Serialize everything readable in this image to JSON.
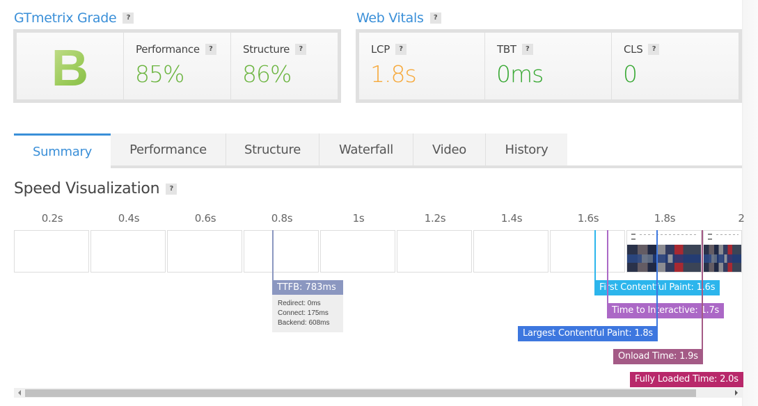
{
  "grade": {
    "title": "GTmetrix Grade",
    "help": "?",
    "letter": "B",
    "metrics": [
      {
        "label": "Performance",
        "help": "?",
        "value": "85%",
        "color": "#6ab43e"
      },
      {
        "label": "Structure",
        "help": "?",
        "value": "86%",
        "color": "#6ab43e"
      }
    ]
  },
  "vitals": {
    "title": "Web Vitals",
    "help": "?",
    "metrics": [
      {
        "label": "LCP",
        "help": "?",
        "value": "1.8s",
        "color": "#f6a93b"
      },
      {
        "label": "TBT",
        "help": "?",
        "value": "0ms",
        "color": "#3aa935"
      },
      {
        "label": "CLS",
        "help": "?",
        "value": "0",
        "color": "#3aa935"
      }
    ]
  },
  "tabs": [
    {
      "label": "Summary",
      "active": true
    },
    {
      "label": "Performance",
      "active": false
    },
    {
      "label": "Structure",
      "active": false
    },
    {
      "label": "Waterfall",
      "active": false
    },
    {
      "label": "Video",
      "active": false
    },
    {
      "label": "History",
      "active": false
    }
  ],
  "speed": {
    "title": "Speed Visualization",
    "help": "?",
    "ticks": [
      "0.2s",
      "0.4s",
      "0.6s",
      "0.8s",
      "1s",
      "1.2s",
      "1.4s",
      "1.6s",
      "1.8s",
      "2"
    ],
    "frames": [
      {
        "time_s": 0.2,
        "screenshot": false
      },
      {
        "time_s": 0.4,
        "screenshot": false
      },
      {
        "time_s": 0.6,
        "screenshot": false
      },
      {
        "time_s": 0.8,
        "screenshot": false
      },
      {
        "time_s": 1.0,
        "screenshot": false
      },
      {
        "time_s": 1.2,
        "screenshot": false
      },
      {
        "time_s": 1.4,
        "screenshot": false
      },
      {
        "time_s": 1.6,
        "screenshot": false
      },
      {
        "time_s": 1.8,
        "screenshot": true
      },
      {
        "time_s": 2.0,
        "screenshot": true
      }
    ],
    "ttfb": {
      "label": "TTFB: 783ms",
      "time_ms": 783,
      "color": "#8b97c0",
      "details": [
        "Redirect: 0ms",
        "Connect: 175ms",
        "Backend: 608ms"
      ]
    },
    "markers": [
      {
        "label": "First Contentful Paint: 1.6s",
        "time_s": 1.6,
        "color": "#2cb5ec",
        "align": "left"
      },
      {
        "label": "Time to Interactive: 1.7s",
        "time_s": 1.7,
        "color": "#ab68c6",
        "align": "left"
      },
      {
        "label": "Largest Contentful Paint: 1.8s",
        "time_s": 1.8,
        "color": "#3d77df",
        "align": "right"
      },
      {
        "label": "Onload Time: 1.9s",
        "time_s": 1.9,
        "color": "#a45a86",
        "align": "right"
      },
      {
        "label": "Fully Loaded Time: 2.0s",
        "time_s": 2.0,
        "color": "#b8286a",
        "align": "right"
      }
    ]
  },
  "scrollbar": {
    "left_arrow": "◂",
    "right_arrow": "▸"
  }
}
